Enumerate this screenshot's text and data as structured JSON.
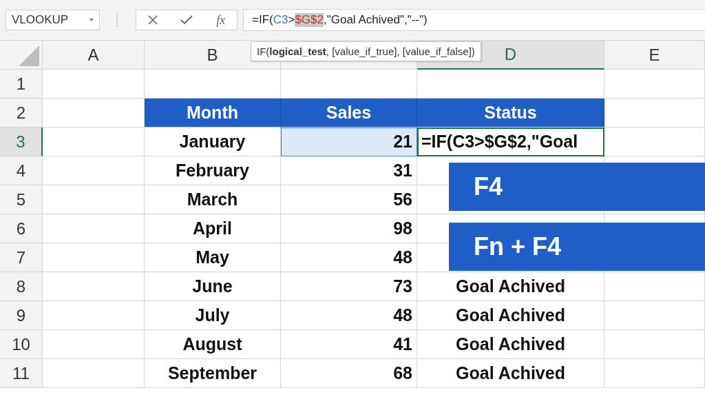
{
  "name_box": {
    "value": "VLOOKUP"
  },
  "formula_bar": {
    "function_label": "fx",
    "segments": [
      {
        "text": "=IF(",
        "color": "#222222",
        "selected": false
      },
      {
        "text": "C3",
        "color": "#3b74b8",
        "selected": false
      },
      {
        "text": ">",
        "color": "#222222",
        "selected": false
      },
      {
        "text": "$G$2",
        "color": "#c0392b",
        "selected": true
      },
      {
        "text": ",\"Goal Achived\",\"--\")",
        "color": "#222222",
        "selected": false
      }
    ]
  },
  "tooltip": "IF(**logical_test**, [value_if_true], [value_if_false])",
  "columns": [
    {
      "label": "A",
      "selected": false
    },
    {
      "label": "B",
      "selected": false
    },
    {
      "selected": false
    },
    {
      "label": "D",
      "selected": true
    },
    {
      "label": "E",
      "selected": false
    }
  ],
  "rows": [
    {
      "number": "1",
      "selected": false,
      "kind": "blank"
    },
    {
      "number": "2",
      "selected": false,
      "kind": "header",
      "month": "Month",
      "sales": "Sales",
      "status": "Status"
    },
    {
      "number": "3",
      "selected": true,
      "kind": "data",
      "month": "January",
      "sales": "21",
      "status": "=IF(C3>$G$2,\"Goal",
      "sales_selected": true,
      "status_editing": true
    },
    {
      "number": "4",
      "selected": false,
      "kind": "data",
      "month": "February",
      "sales": "31",
      "sales_selected": false,
      "status_editing": false
    },
    {
      "number": "5",
      "selected": false,
      "kind": "data",
      "month": "March",
      "sales": "56",
      "sales_selected": false,
      "status_editing": false
    },
    {
      "number": "6",
      "selected": false,
      "kind": "data",
      "month": "April",
      "sales": "98",
      "sales_selected": false,
      "status_editing": false
    },
    {
      "number": "7",
      "selected": false,
      "kind": "data",
      "month": "May",
      "sales": "48",
      "sales_selected": false,
      "status_editing": false
    },
    {
      "number": "8",
      "selected": false,
      "kind": "data",
      "month": "June",
      "sales": "73",
      "status": "Goal Achived",
      "sales_selected": false,
      "status_editing": false
    },
    {
      "number": "9",
      "selected": false,
      "kind": "data",
      "month": "July",
      "sales": "48",
      "status": "Goal Achived",
      "sales_selected": false,
      "status_editing": false
    },
    {
      "number": "10",
      "selected": false,
      "kind": "data",
      "month": "August",
      "sales": "41",
      "status": "Goal Achived",
      "sales_selected": false,
      "status_editing": false
    },
    {
      "number": "11",
      "selected": false,
      "kind": "data",
      "month": "September",
      "sales": "68",
      "status": "Goal Achived",
      "sales_selected": false,
      "status_editing": false
    }
  ],
  "banners": [
    {
      "label": "F4"
    },
    {
      "label": "Fn + F4"
    }
  ]
}
